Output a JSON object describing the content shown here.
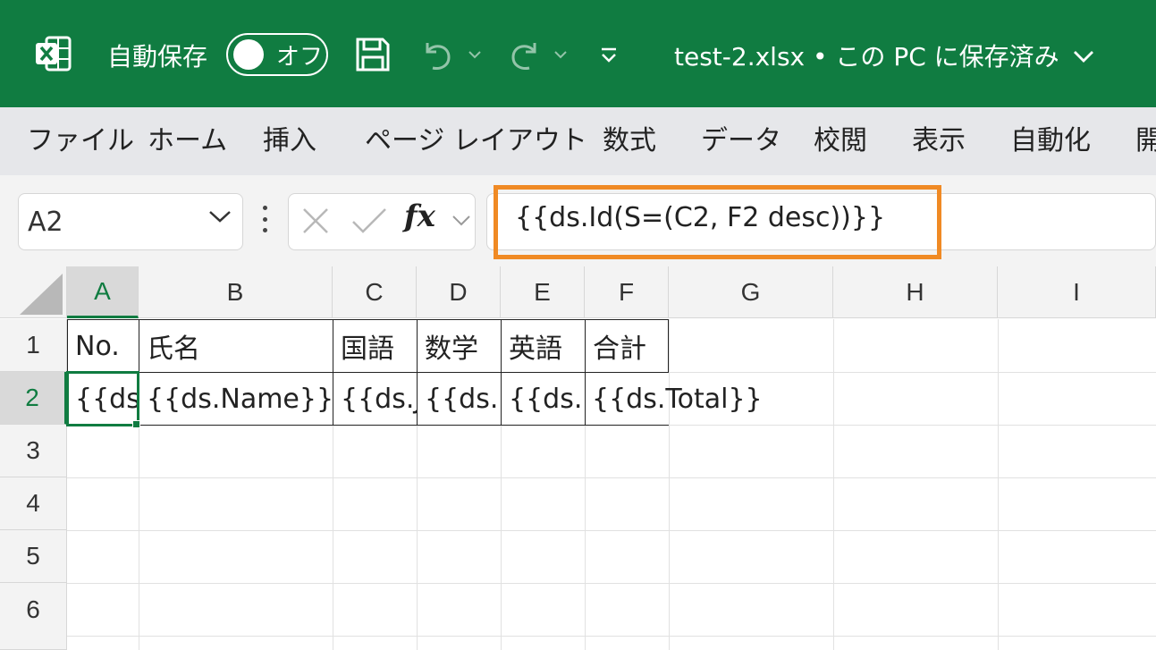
{
  "titlebar": {
    "autosave_label": "自動保存",
    "toggle_label": "オフ",
    "doc_title": "test-2.xlsx • この PC に保存済み",
    "colors": {
      "brand": "#107c41"
    },
    "icons": [
      "excel-logo-icon",
      "save-icon",
      "undo-icon",
      "redo-icon",
      "quick-access-dropdown-icon"
    ]
  },
  "ribbon": {
    "tabs": [
      "ファイル",
      "ホーム",
      "挿入",
      "ページ レイアウト",
      "数式",
      "データ",
      "校閲",
      "表示",
      "自動化",
      "開"
    ]
  },
  "formula_bar": {
    "name_box": "A2",
    "fx": "fx",
    "formula": "{{ds.Id(S=(C2, F2 desc))}}",
    "highlight_color": "#f08a24"
  },
  "grid": {
    "columns": [
      "A",
      "B",
      "C",
      "D",
      "E",
      "F",
      "G",
      "H",
      "I"
    ],
    "rows": [
      "1",
      "2",
      "3",
      "4",
      "5",
      "6"
    ],
    "active_cell": "A2",
    "cells": {
      "A1": "No.",
      "B1": "氏名",
      "C1": "国語",
      "D1": "数学",
      "E1": "英語",
      "F1": "合計",
      "A2": "{{ds",
      "B2": "{{ds.Name}}",
      "C2": "{{ds.J",
      "D2": "{{ds.M",
      "E2": "{{ds.E",
      "F2": "{{ds.Total}}"
    }
  }
}
